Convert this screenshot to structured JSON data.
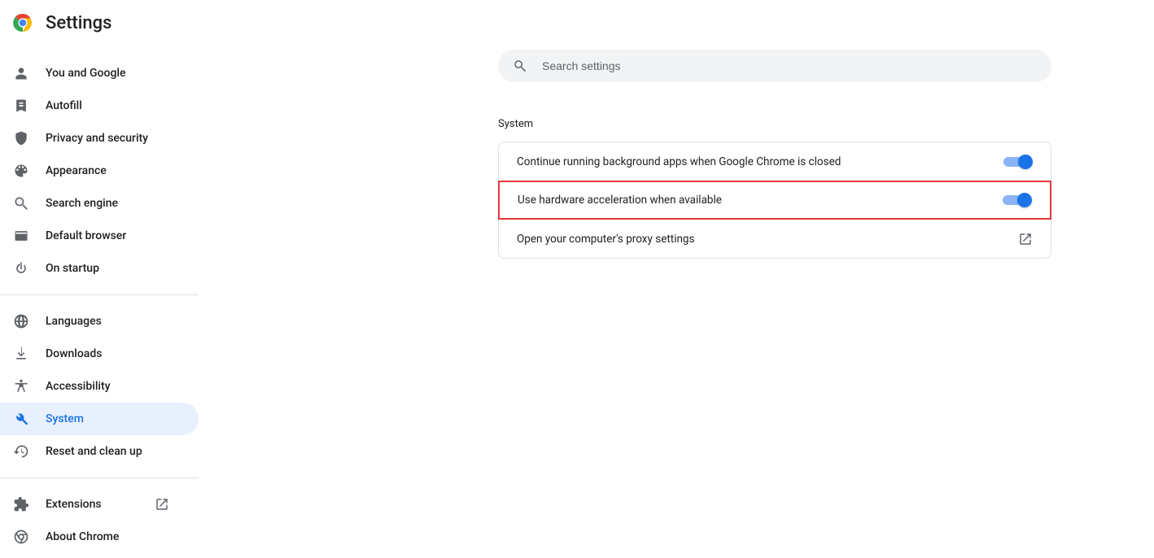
{
  "header": {
    "title": "Settings"
  },
  "search": {
    "placeholder": "Search settings"
  },
  "sidebar": {
    "groups": [
      [
        {
          "id": "you-and-google",
          "label": "You and Google",
          "icon": "person",
          "active": false
        },
        {
          "id": "autofill",
          "label": "Autofill",
          "icon": "autofill",
          "active": false
        },
        {
          "id": "privacy",
          "label": "Privacy and security",
          "icon": "shield",
          "active": false
        },
        {
          "id": "appearance",
          "label": "Appearance",
          "icon": "palette",
          "active": false
        },
        {
          "id": "search-engine",
          "label": "Search engine",
          "icon": "search",
          "active": false
        },
        {
          "id": "default-browser",
          "label": "Default browser",
          "icon": "browser",
          "active": false
        },
        {
          "id": "on-startup",
          "label": "On startup",
          "icon": "power",
          "active": false
        }
      ],
      [
        {
          "id": "languages",
          "label": "Languages",
          "icon": "globe",
          "active": false
        },
        {
          "id": "downloads",
          "label": "Downloads",
          "icon": "download",
          "active": false
        },
        {
          "id": "accessibility",
          "label": "Accessibility",
          "icon": "accessibility",
          "active": false
        },
        {
          "id": "system",
          "label": "System",
          "icon": "wrench",
          "active": true
        },
        {
          "id": "reset",
          "label": "Reset and clean up",
          "icon": "restore",
          "active": false
        }
      ],
      [
        {
          "id": "extensions",
          "label": "Extensions",
          "icon": "extension",
          "active": false,
          "external": true
        },
        {
          "id": "about",
          "label": "About Chrome",
          "icon": "chrome-outline",
          "active": false
        }
      ]
    ]
  },
  "section": {
    "title": "System"
  },
  "rows": {
    "bg_apps": {
      "label": "Continue running background apps when Google Chrome is closed",
      "on": true
    },
    "hw_accel": {
      "label": "Use hardware acceleration when available",
      "on": true,
      "highlight": true
    },
    "proxy": {
      "label": "Open your computer's proxy settings"
    }
  },
  "icons": {
    "person": "person-icon",
    "autofill": "autofill-icon",
    "shield": "shield-icon",
    "palette": "palette-icon",
    "search": "search-icon",
    "browser": "browser-icon",
    "power": "power-icon",
    "globe": "globe-icon",
    "download": "download-icon",
    "accessibility": "accessibility-icon",
    "wrench": "wrench-icon",
    "restore": "restore-icon",
    "extension": "extension-icon",
    "chrome-outline": "chrome-outline-icon",
    "open-external": "open-external-icon"
  }
}
